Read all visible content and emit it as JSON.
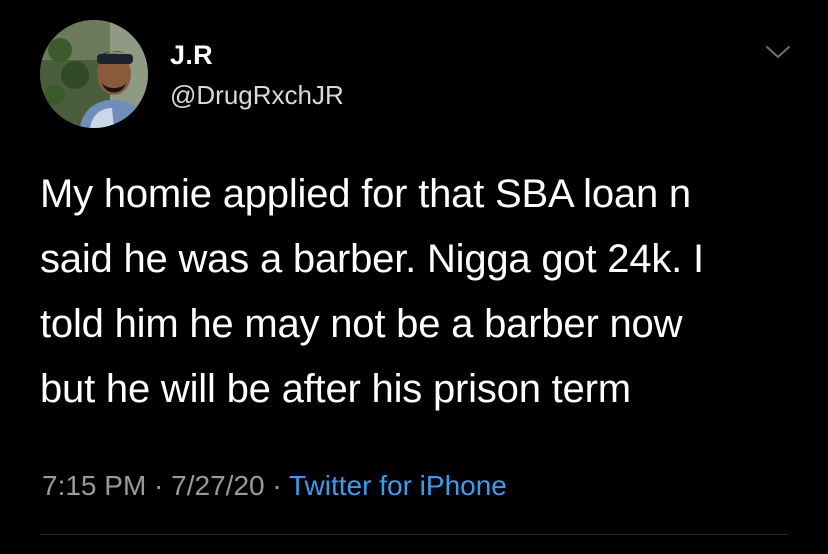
{
  "author": {
    "display_name": "J.R",
    "handle": "@DrugRxchJR"
  },
  "tweet": {
    "text": "My homie applied for that SBA loan n\nsaid he was a barber. Nigga got 24k. I\ntold him he may not be a barber now\nbut he will be after his prison term"
  },
  "meta": {
    "time": "7:15 PM",
    "separator": " · ",
    "date": "7/27/20",
    "source": "Twitter for iPhone"
  },
  "colors": {
    "background": "#000000",
    "text_primary": "#ffffff",
    "text_secondary": "#9a9a9a",
    "link": "#3a9cf0"
  },
  "icons": {
    "menu": "chevron-down-icon"
  }
}
